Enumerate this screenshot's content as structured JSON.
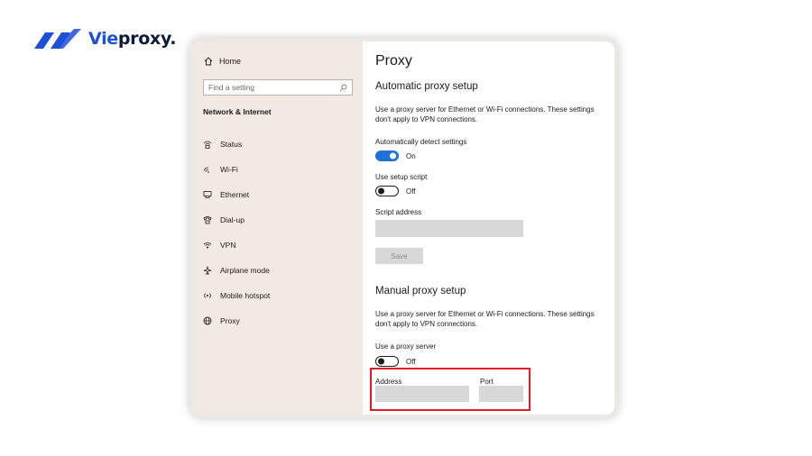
{
  "brand": {
    "name_main": "Vie",
    "name_rest": "proxy",
    "name_dot": ".",
    "color_dark": "#0b1b3a",
    "color_accent": "#1f4fd8"
  },
  "sidebar": {
    "home_label": "Home",
    "search_placeholder": "Find a setting",
    "section_title": "Network & Internet",
    "items": [
      {
        "label": "Status",
        "icon": "status-icon"
      },
      {
        "label": "Wi-Fi",
        "icon": "wifi-icon"
      },
      {
        "label": "Ethernet",
        "icon": "ethernet-icon"
      },
      {
        "label": "Dial-up",
        "icon": "dialup-icon"
      },
      {
        "label": "VPN",
        "icon": "vpn-icon"
      },
      {
        "label": "Airplane mode",
        "icon": "airplane-icon"
      },
      {
        "label": "Mobile hotspot",
        "icon": "hotspot-icon"
      },
      {
        "label": "Proxy",
        "icon": "globe-icon"
      }
    ]
  },
  "main": {
    "title": "Proxy",
    "automatic": {
      "heading": "Automatic proxy setup",
      "description": "Use a proxy server for Ethernet or Wi-Fi connections. These settings don't apply to VPN connections.",
      "auto_detect_label": "Automatically detect settings",
      "auto_detect_state": "On",
      "setup_script_label": "Use setup script",
      "setup_script_state": "Off",
      "script_address_label": "Script address",
      "script_address_value": "",
      "save_label": "Save"
    },
    "manual": {
      "heading": "Manual proxy setup",
      "description": "Use a proxy server for Ethernet or Wi-Fi connections. These settings don't apply to VPN connections.",
      "use_proxy_label": "Use a proxy server",
      "use_proxy_state": "Off",
      "address_label": "Address",
      "address_value": "",
      "port_label": "Port",
      "port_value": ""
    }
  },
  "colors": {
    "toggle_on": "#1e73d8",
    "sidebar_bg": "#f3e9e3",
    "highlight": "#e01b24"
  }
}
